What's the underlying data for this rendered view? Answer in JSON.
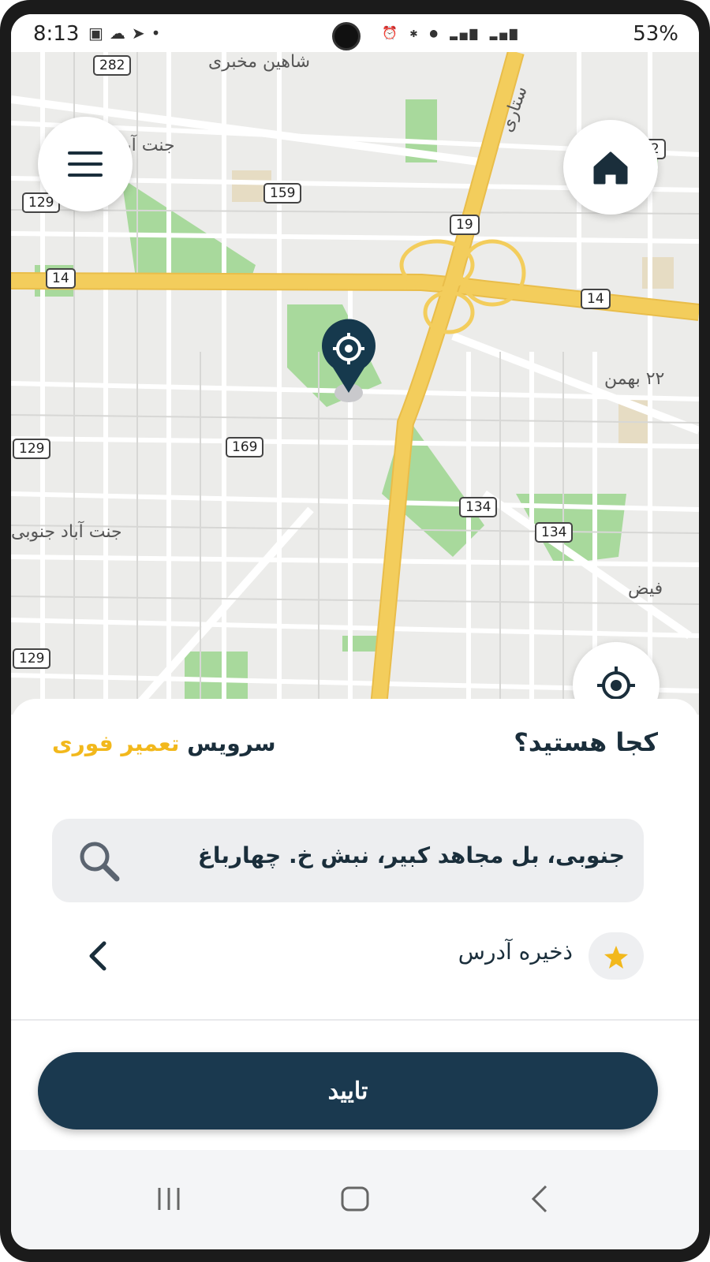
{
  "status_bar": {
    "time": "8:13",
    "left_icons": [
      "image-icon",
      "cloud-icon",
      "telegram-icon",
      "dot-icon"
    ],
    "right_icons": [
      "alarm-icon",
      "bluetooth-icon",
      "location-icon",
      "volte-lte1-icon",
      "4g-icon",
      "signal-icon",
      "volte-lte2-icon",
      "signal-icon"
    ],
    "battery": "53%"
  },
  "map": {
    "labels": [
      "شاهین مخبری",
      "جنت آباد",
      "جنت آباد جنوبی",
      "۲۲ بهمن",
      "ستاری",
      "فیض"
    ],
    "route_shields": [
      "282",
      "159",
      "129",
      "19",
      "14",
      "14",
      "129",
      "169",
      "134",
      "134",
      "129",
      "52"
    ],
    "colors": {
      "major_road": "#f3cd5c",
      "park": "#a8d99c",
      "block": "#e9e9e6",
      "street": "#ffffff",
      "pin": "#16394d"
    }
  },
  "buttons": {
    "menu_icon": "hamburger-menu-icon",
    "home_icon": "home-icon",
    "locate_icon": "crosshair-icon",
    "pin_icon": "gear-pin-icon"
  },
  "sheet": {
    "title": "کجا هستید؟",
    "service_label": "سرویس",
    "service_accent": "تعمیر فوری",
    "search_value": "جنوبی، بل مجاهد کبیر، نبش خ. چهارباغ",
    "save_address_label": "ذخیره آدرس",
    "confirm_label": "تایید"
  },
  "nav_bar": {
    "icons": [
      "recent-apps-icon",
      "home-nav-icon",
      "back-nav-icon"
    ]
  }
}
